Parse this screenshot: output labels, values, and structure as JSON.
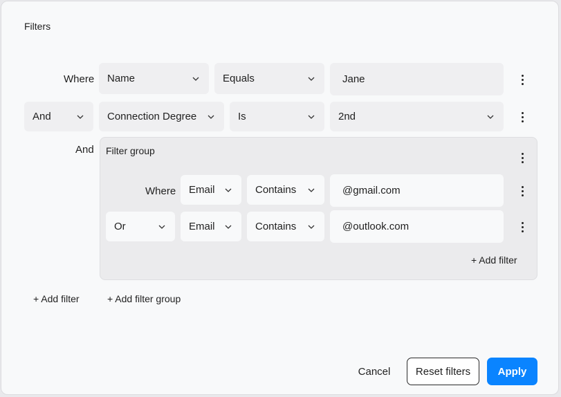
{
  "dialog": {
    "title": "Filters",
    "rows": [
      {
        "conjunction": "Where",
        "field": "Name",
        "operator": "Equals",
        "value": "Jane"
      },
      {
        "conjunction": "And",
        "field": "Connection Degree",
        "operator": "Is",
        "value": "2nd"
      }
    ],
    "group": {
      "conjunction": "And",
      "title": "Filter group",
      "rows": [
        {
          "conjunction": "Where",
          "field": "Email",
          "operator": "Contains",
          "value": "@gmail.com"
        },
        {
          "conjunction": "Or",
          "field": "Email",
          "operator": "Contains",
          "value": "@outlook.com"
        }
      ],
      "add_filter_label": "+ Add filter"
    },
    "add_filter_label": "+ Add filter",
    "add_filter_group_label": "+ Add filter group",
    "buttons": {
      "cancel": "Cancel",
      "reset": "Reset filters",
      "apply": "Apply"
    },
    "colors": {
      "accent": "#0a84ff"
    }
  }
}
